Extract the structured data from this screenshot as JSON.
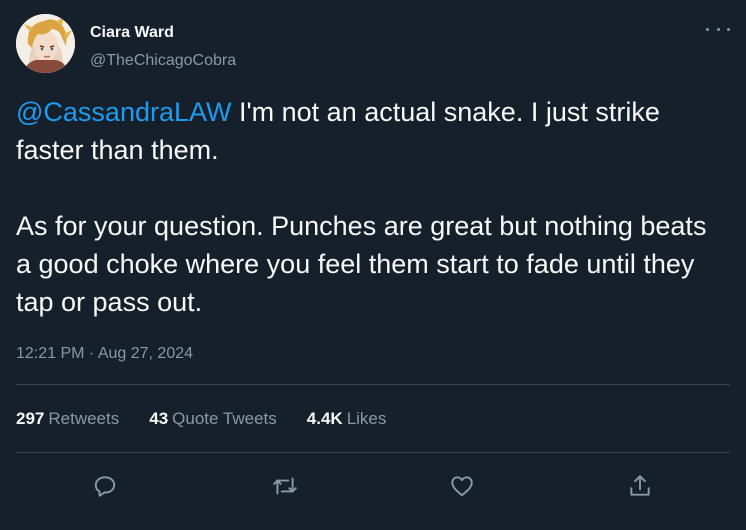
{
  "author": {
    "display_name": "Ciara Ward",
    "handle": "@TheChicagoCobra"
  },
  "tweet": {
    "mention": "@CassandraLAW",
    "line1_rest": " I'm not an actual snake. I just strike faster than them.",
    "paragraph2": "As for your question. Punches are great but nothing beats a good choke where you feel them start to fade until they tap or pass out.",
    "time": "12:21 PM",
    "separator": " · ",
    "date": "Aug 27, 2024"
  },
  "stats": {
    "retweets_count": "297",
    "retweets_label": "Retweets",
    "quotes_count": "43",
    "quotes_label": "Quote Tweets",
    "likes_count": "4.4K",
    "likes_label": "Likes"
  },
  "icons": {
    "more": "more-horizontal-icon",
    "reply": "reply-icon",
    "retweet": "retweet-icon",
    "like": "heart-icon",
    "share": "share-icon"
  },
  "colors": {
    "background": "#15202b",
    "accent": "#1d9bf0",
    "text_primary": "#f7f9f9",
    "text_secondary": "#8b98a5",
    "divider": "#38444d"
  }
}
